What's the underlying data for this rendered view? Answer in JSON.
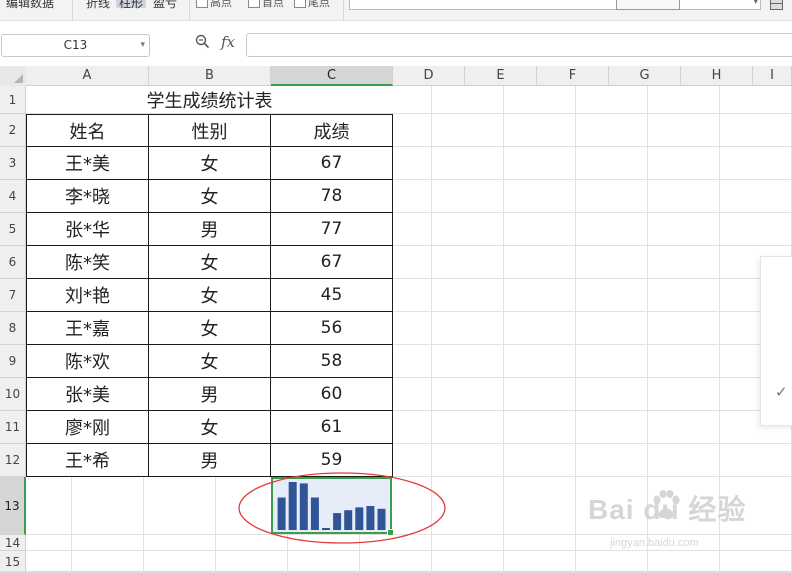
{
  "ribbon": {
    "item1": "编辑数据",
    "item2": "折线",
    "item3": "柱形",
    "item4": "盈亏",
    "chk1": "高点",
    "chk2": "首点",
    "chk3": "尾点"
  },
  "formula_bar": {
    "name_box": "C13",
    "fx_label": "fx",
    "formula": ""
  },
  "columns": [
    "A",
    "B",
    "C",
    "D",
    "E",
    "F",
    "G",
    "H",
    "I"
  ],
  "rows": [
    "1",
    "2",
    "3",
    "4",
    "5",
    "6",
    "7",
    "8",
    "9",
    "10",
    "11",
    "12",
    "13",
    "14",
    "15"
  ],
  "sheet": {
    "title": "学生成绩统计表",
    "headers": [
      "姓名",
      "性别",
      "成绩"
    ],
    "records": [
      {
        "name": "王*美",
        "gender": "女",
        "score": "67"
      },
      {
        "name": "李*晓",
        "gender": "女",
        "score": "78"
      },
      {
        "name": "张*华",
        "gender": "男",
        "score": "77"
      },
      {
        "name": "陈*笑",
        "gender": "女",
        "score": "67"
      },
      {
        "name": "刘*艳",
        "gender": "女",
        "score": "45"
      },
      {
        "name": "王*嘉",
        "gender": "女",
        "score": "56"
      },
      {
        "name": "陈*欢",
        "gender": "女",
        "score": "58"
      },
      {
        "name": "张*美",
        "gender": "男",
        "score": "60"
      },
      {
        "name": "廖*刚",
        "gender": "女",
        "score": "61"
      },
      {
        "name": "王*希",
        "gender": "男",
        "score": "59"
      }
    ]
  },
  "chart_data": {
    "type": "bar",
    "categories": [
      "王*美",
      "李*晓",
      "张*华",
      "陈*笑",
      "刘*艳",
      "王*嘉",
      "陈*欢",
      "张*美",
      "廖*刚",
      "王*希"
    ],
    "values": [
      67,
      78,
      77,
      67,
      45,
      56,
      58,
      60,
      61,
      59
    ],
    "ylim": [
      44,
      78
    ],
    "color": "#2f5597"
  },
  "colors": {
    "selection": "#3a9e4a",
    "sparkline_bg": "#e6ecf8",
    "annotation": "#e03a3a"
  },
  "watermark": {
    "main": "Bai  du 经验",
    "sub": "jingyan.baidu.com"
  }
}
